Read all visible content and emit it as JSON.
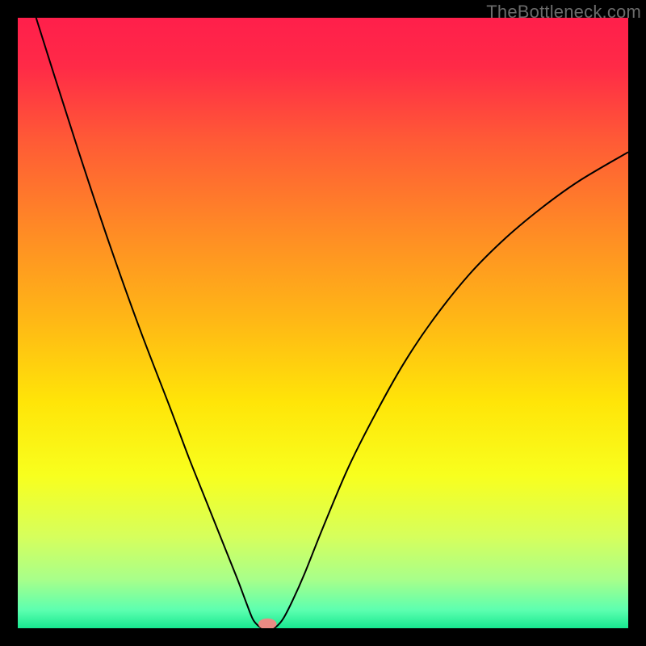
{
  "watermark": "TheBottleneck.com",
  "chart_data": {
    "type": "line",
    "title": "",
    "xlabel": "",
    "ylabel": "",
    "xlim": [
      0,
      100
    ],
    "ylim": [
      0,
      100
    ],
    "background_gradient": {
      "stops": [
        {
          "t": 0.0,
          "color": "#ff1f4b"
        },
        {
          "t": 0.08,
          "color": "#ff2a47"
        },
        {
          "t": 0.2,
          "color": "#ff5a36"
        },
        {
          "t": 0.35,
          "color": "#ff8b25"
        },
        {
          "t": 0.5,
          "color": "#ffb915"
        },
        {
          "t": 0.63,
          "color": "#ffe508"
        },
        {
          "t": 0.75,
          "color": "#f8ff1e"
        },
        {
          "t": 0.85,
          "color": "#d6ff5c"
        },
        {
          "t": 0.92,
          "color": "#a8ff8a"
        },
        {
          "t": 0.97,
          "color": "#5dffb0"
        },
        {
          "t": 1.0,
          "color": "#17e890"
        }
      ]
    },
    "series": [
      {
        "name": "bottleneck-curve",
        "color": "#000000",
        "points": [
          {
            "x": 3.0,
            "y": 100.0
          },
          {
            "x": 6.0,
            "y": 90.5
          },
          {
            "x": 10.0,
            "y": 78.0
          },
          {
            "x": 15.0,
            "y": 63.0
          },
          {
            "x": 20.0,
            "y": 49.0
          },
          {
            "x": 25.0,
            "y": 36.0
          },
          {
            "x": 28.0,
            "y": 28.0
          },
          {
            "x": 31.0,
            "y": 20.5
          },
          {
            "x": 34.0,
            "y": 13.0
          },
          {
            "x": 36.0,
            "y": 8.0
          },
          {
            "x": 37.5,
            "y": 4.0
          },
          {
            "x": 38.5,
            "y": 1.5
          },
          {
            "x": 39.4,
            "y": 0.4
          },
          {
            "x": 40.2,
            "y": 0.0
          },
          {
            "x": 41.6,
            "y": 0.0
          },
          {
            "x": 42.4,
            "y": 0.3
          },
          {
            "x": 43.5,
            "y": 1.6
          },
          {
            "x": 45.0,
            "y": 4.5
          },
          {
            "x": 47.0,
            "y": 9.0
          },
          {
            "x": 50.0,
            "y": 16.5
          },
          {
            "x": 54.0,
            "y": 26.0
          },
          {
            "x": 58.0,
            "y": 34.0
          },
          {
            "x": 63.0,
            "y": 43.0
          },
          {
            "x": 68.0,
            "y": 50.5
          },
          {
            "x": 74.0,
            "y": 58.0
          },
          {
            "x": 80.0,
            "y": 64.0
          },
          {
            "x": 86.0,
            "y": 69.0
          },
          {
            "x": 92.0,
            "y": 73.3
          },
          {
            "x": 100.0,
            "y": 78.0
          }
        ]
      }
    ],
    "marker": {
      "name": "bottleneck-point",
      "x": 40.9,
      "y": 0.7,
      "color": "#ea8b84",
      "rx": 1.5,
      "ry": 0.9
    }
  }
}
